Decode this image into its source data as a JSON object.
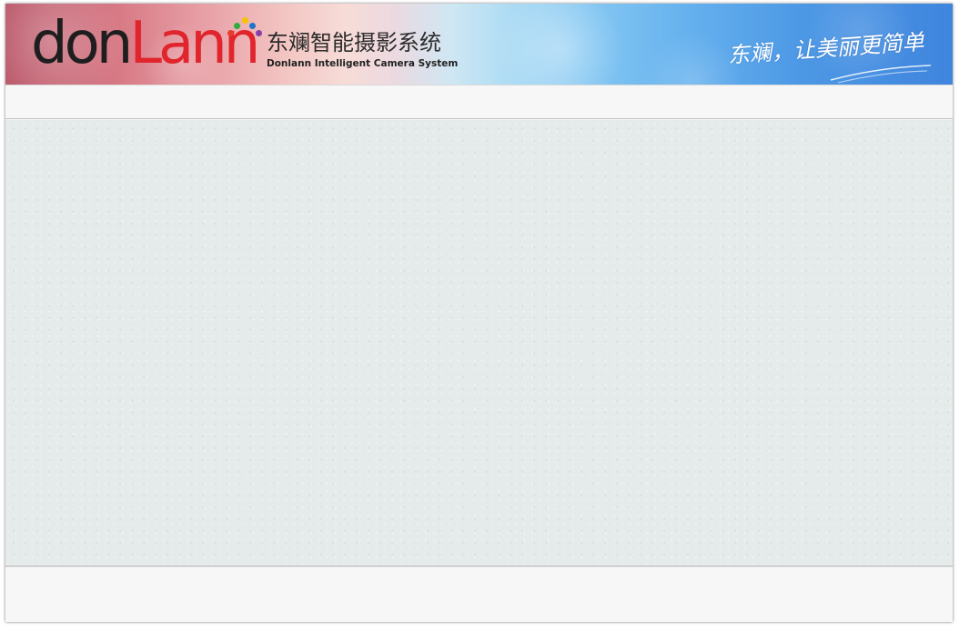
{
  "header": {
    "logo": {
      "part1": "don",
      "part2": "Lann"
    },
    "title_cn": "东斓智能摄影系统",
    "title_en": "Donlann Intelligent Camera System",
    "slogan": "东斓，让美丽更简单"
  },
  "colors": {
    "logo_dark": "#1e1e1e",
    "logo_red": "#e1252c",
    "logo_dots": [
      "#e83a2f",
      "#f5c400",
      "#2fae3c",
      "#1f73c9",
      "#8a3ea8"
    ],
    "banner_left": "#b95567",
    "banner_right": "#3f85de",
    "content_bg": "#e5eaea",
    "panel_bg": "#f7f7f7"
  }
}
